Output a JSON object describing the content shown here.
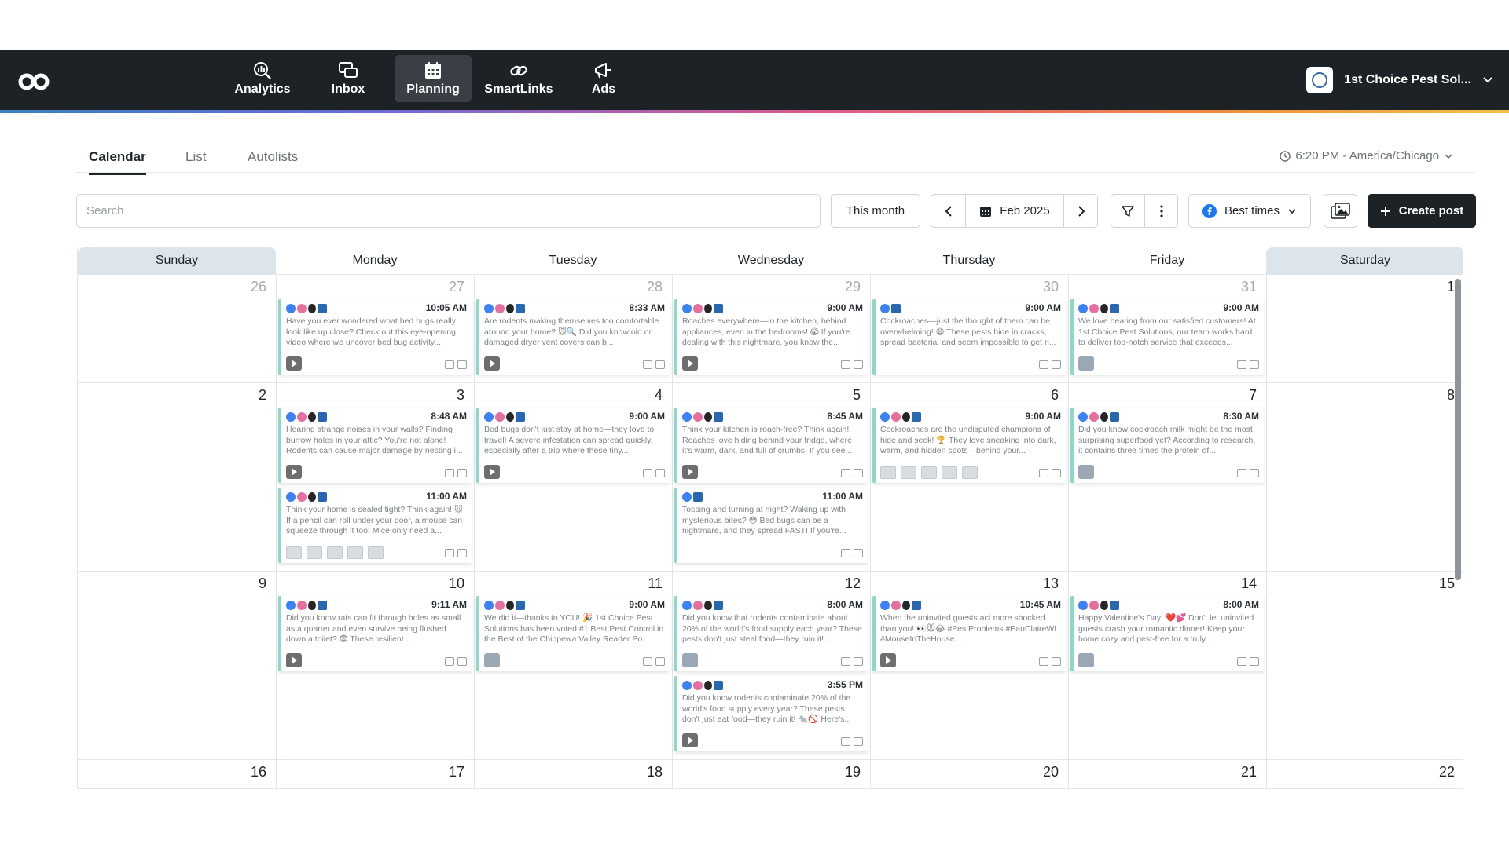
{
  "nav": {
    "items": [
      {
        "label": "Analytics",
        "icon": "analytics-icon"
      },
      {
        "label": "Inbox",
        "icon": "inbox-icon"
      },
      {
        "label": "Planning",
        "icon": "calendar-icon",
        "active": true
      },
      {
        "label": "SmartLinks",
        "icon": "link-icon"
      },
      {
        "label": "Ads",
        "icon": "megaphone-icon"
      }
    ],
    "account_name": "1st Choice Pest Sol..."
  },
  "tabs": [
    {
      "label": "Calendar",
      "active": true
    },
    {
      "label": "List"
    },
    {
      "label": "Autolists"
    }
  ],
  "timezone": "6:20 PM - America/Chicago",
  "toolbar": {
    "search_placeholder": "Search",
    "this_month": "This month",
    "month": "Feb 2025",
    "best_times": "Best times",
    "create_post": "Create post"
  },
  "calendar": {
    "weekdays": [
      "Sunday",
      "Monday",
      "Tuesday",
      "Wednesday",
      "Thursday",
      "Friday",
      "Saturday"
    ],
    "weeks": [
      {
        "days": [
          "26",
          "27",
          "28",
          "29",
          "30",
          "31",
          "1"
        ],
        "muted": [
          true,
          true,
          true,
          true,
          true,
          true,
          false
        ]
      },
      {
        "days": [
          "2",
          "3",
          "4",
          "5",
          "6",
          "7",
          "8"
        ]
      },
      {
        "days": [
          "9",
          "10",
          "11",
          "12",
          "13",
          "14",
          "15"
        ]
      },
      {
        "days": [
          "16",
          "17",
          "18",
          "19",
          "20",
          "21",
          "22"
        ]
      }
    ],
    "posts": [
      {
        "id": "p1",
        "time": "10:05 AM",
        "text": "Have you ever wondered what bed bugs really look like up close? Check out this eye-opening video where we uncover bed bug activity,..."
      },
      {
        "id": "p2",
        "time": "8:33 AM",
        "text": "Are rodents making themselves too comfortable around your home? 🐭🔍 Did you know old or damaged dryer vent covers can b..."
      },
      {
        "id": "p3",
        "time": "9:00 AM",
        "text": "Roaches everywhere—in the kitchen, behind appliances, even in the bedrooms! 😱 If you're dealing with this nightmare, you know the..."
      },
      {
        "id": "p4",
        "time": "9:00 AM",
        "text": "Cockroaches—just the thought of them can be overwhelming! 😩 These pests hide in cracks, spread bacteria, and seem impossible to get ri..."
      },
      {
        "id": "p5",
        "time": "9:00 AM",
        "text": "We love hearing from our satisfied customers! At 1st Choice Pest Solutions, our team works hard to deliver top-notch service that exceeds..."
      },
      {
        "id": "p6",
        "time": "8:48 AM",
        "text": "Hearing strange noises in your walls? Finding burrow holes in your attic? You're not alone! Rodents can cause major damage by nesting i..."
      },
      {
        "id": "p7",
        "time": "11:00 AM",
        "text": "Think your home is sealed tight? Think again! 🐭 If a pencil can roll under your door, a mouse can squeeze through it too! Mice only need a..."
      },
      {
        "id": "p8",
        "time": "9:00 AM",
        "text": "Bed bugs don't just stay at home—they love to travel! A severe infestation can spread quickly, especially after a trip where these tiny..."
      },
      {
        "id": "p9",
        "time": "8:45 AM",
        "text": "Think your kitchen is roach-free? Think again! Roaches love hiding behind your fridge, where it's warm, dark, and full of crumbs. If you see..."
      },
      {
        "id": "p10",
        "time": "11:00 AM",
        "text": "Tossing and turning at night? Waking up with mysterious bites? 😳 Bed bugs can be a nightmare, and they spread FAST! If you're..."
      },
      {
        "id": "p11",
        "time": "9:00 AM",
        "text": "Cockroaches are the undisputed champions of hide and seek! 🏆 They love sneaking into dark, warm, and hidden spots—behind your..."
      },
      {
        "id": "p12",
        "time": "8:30 AM",
        "text": "Did you know cockroach milk might be the most surprising superfood yet? According to research, it contains three times the protein of..."
      },
      {
        "id": "p13",
        "time": "9:11 AM",
        "text": "Did you know rats can fit through holes as small as a quarter and even survive being flushed down a toilet? 😨 These resilient..."
      },
      {
        "id": "p14",
        "time": "9:00 AM",
        "text": "We did it—thanks to YOU! 🎉 1st Choice Pest Solutions has been voted #1 Best Pest Control in the Best of the Chippewa Valley Reader Po..."
      },
      {
        "id": "p15",
        "time": "8:00 AM",
        "text": "Did you know that rodents contaminate about 20% of the world's food supply each year? These pests don't just steal food—they ruin it!..."
      },
      {
        "id": "p16",
        "time": "3:55 PM",
        "text": "Did you know rodents contaminate 20% of the world's food supply every year? These pests don't just eat food—they ruin it! 🐀🚫 Here's..."
      },
      {
        "id": "p17",
        "time": "10:45 AM",
        "text": "When the uninvited guests act more shocked than you! 👀🐭😂 #PestProblems #EauClaireWI #MouseInTheHouse..."
      },
      {
        "id": "p18",
        "time": "8:00 AM",
        "text": "Happy Valentine's Day! ❤️💕 Don't let uninvited guests crash your romantic dinner! Keep your home cozy and pest-free for a truly..."
      }
    ]
  }
}
